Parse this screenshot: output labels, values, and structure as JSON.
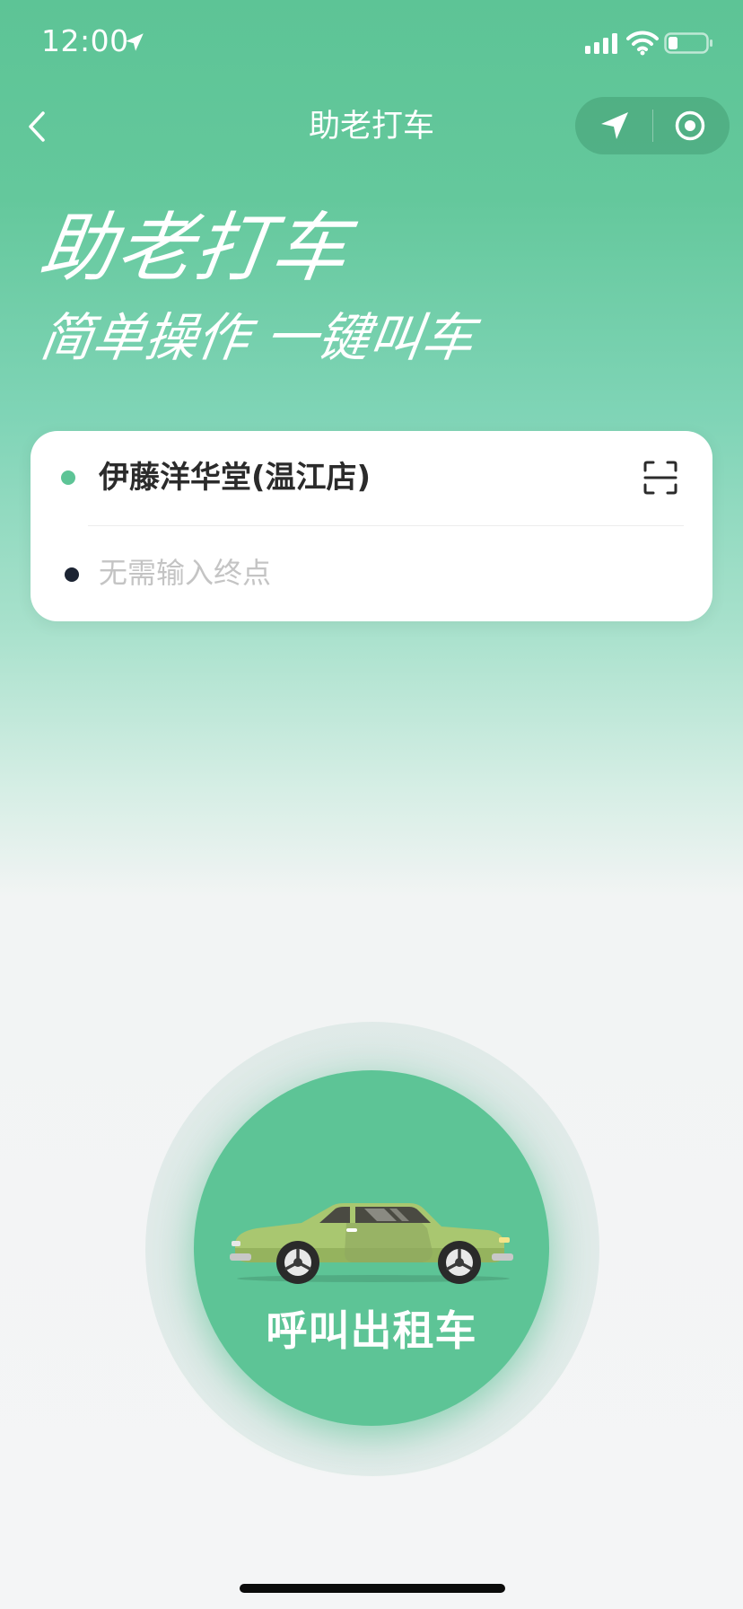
{
  "status_bar": {
    "time": "12:00",
    "icons": [
      "location-arrow-icon",
      "signal-icon",
      "wifi-icon",
      "battery-icon"
    ]
  },
  "nav": {
    "title": "助老打车",
    "back_icon": "chevron-left-icon",
    "capsule_icons": [
      "navigation-icon",
      "target-icon"
    ]
  },
  "hero": {
    "title": "助老打车",
    "subtitle": "简单操作 一键叫车"
  },
  "trip": {
    "from": "伊藤洋华堂(温江店)",
    "to_value": "",
    "to_placeholder": "无需输入终点",
    "scan_icon": "scan-icon"
  },
  "call_button": {
    "label": "呼叫出租车",
    "icon": "taxi-car-icon"
  },
  "colors": {
    "brand_green": "#5dc496",
    "dot_dark": "#1c2433",
    "placeholder_gray": "#c4c4c4"
  }
}
